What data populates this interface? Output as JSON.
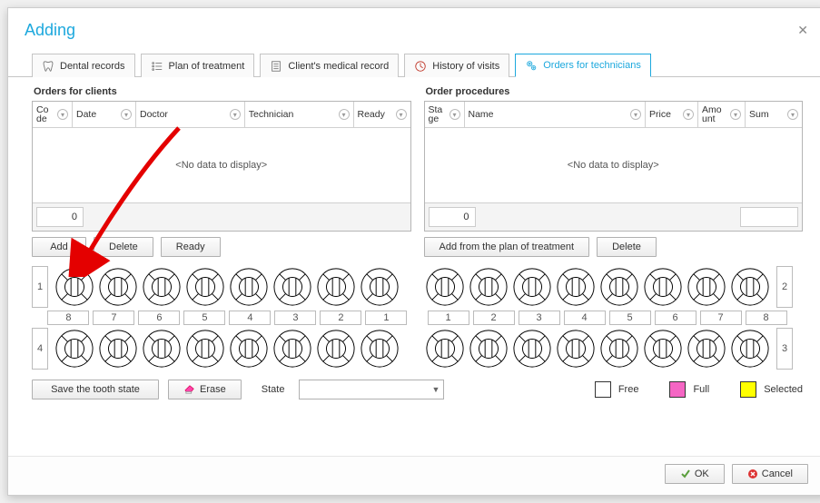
{
  "dialog": {
    "title": "Adding"
  },
  "tabs": [
    {
      "label": "Dental records",
      "icon": "tooth-icon"
    },
    {
      "label": "Plan of treatment",
      "icon": "list-icon"
    },
    {
      "label": "Client's medical record",
      "icon": "document-icon"
    },
    {
      "label": "History of visits",
      "icon": "clock-icon"
    },
    {
      "label": "Orders for technicians",
      "icon": "gears-icon",
      "active": true
    }
  ],
  "orders_clients": {
    "title": "Orders for clients",
    "columns": [
      "Code",
      "Date",
      "Doctor",
      "Technician",
      "Ready"
    ],
    "empty_text": "<No data to display>",
    "footer_value": "0",
    "buttons": {
      "add": "Add",
      "delete": "Delete",
      "ready": "Ready"
    }
  },
  "order_procedures": {
    "title": "Order procedures",
    "columns": [
      "Stage",
      "Name",
      "Price",
      "Amount",
      "Sum"
    ],
    "empty_text": "<No data to display>",
    "footer_value": "0",
    "buttons": {
      "add_from_plan": "Add from the plan of treatment",
      "delete": "Delete"
    }
  },
  "tooth_chart": {
    "quadrants": {
      "top_left": "1",
      "top_right": "2",
      "bottom_left": "4",
      "bottom_right": "3"
    },
    "numbers_left": [
      "8",
      "7",
      "6",
      "5",
      "4",
      "3",
      "2",
      "1"
    ],
    "numbers_right": [
      "1",
      "2",
      "3",
      "4",
      "5",
      "6",
      "7",
      "8"
    ]
  },
  "state_bar": {
    "save_btn": "Save the tooth state",
    "erase_btn": "Erase",
    "state_label": "State",
    "state_value": "",
    "legend": {
      "free": "Free",
      "full": "Full",
      "selected": "Selected"
    },
    "colors": {
      "free": "#ffffff",
      "full": "#f566c4",
      "selected": "#ffff00"
    }
  },
  "footer": {
    "ok": "OK",
    "cancel": "Cancel"
  }
}
